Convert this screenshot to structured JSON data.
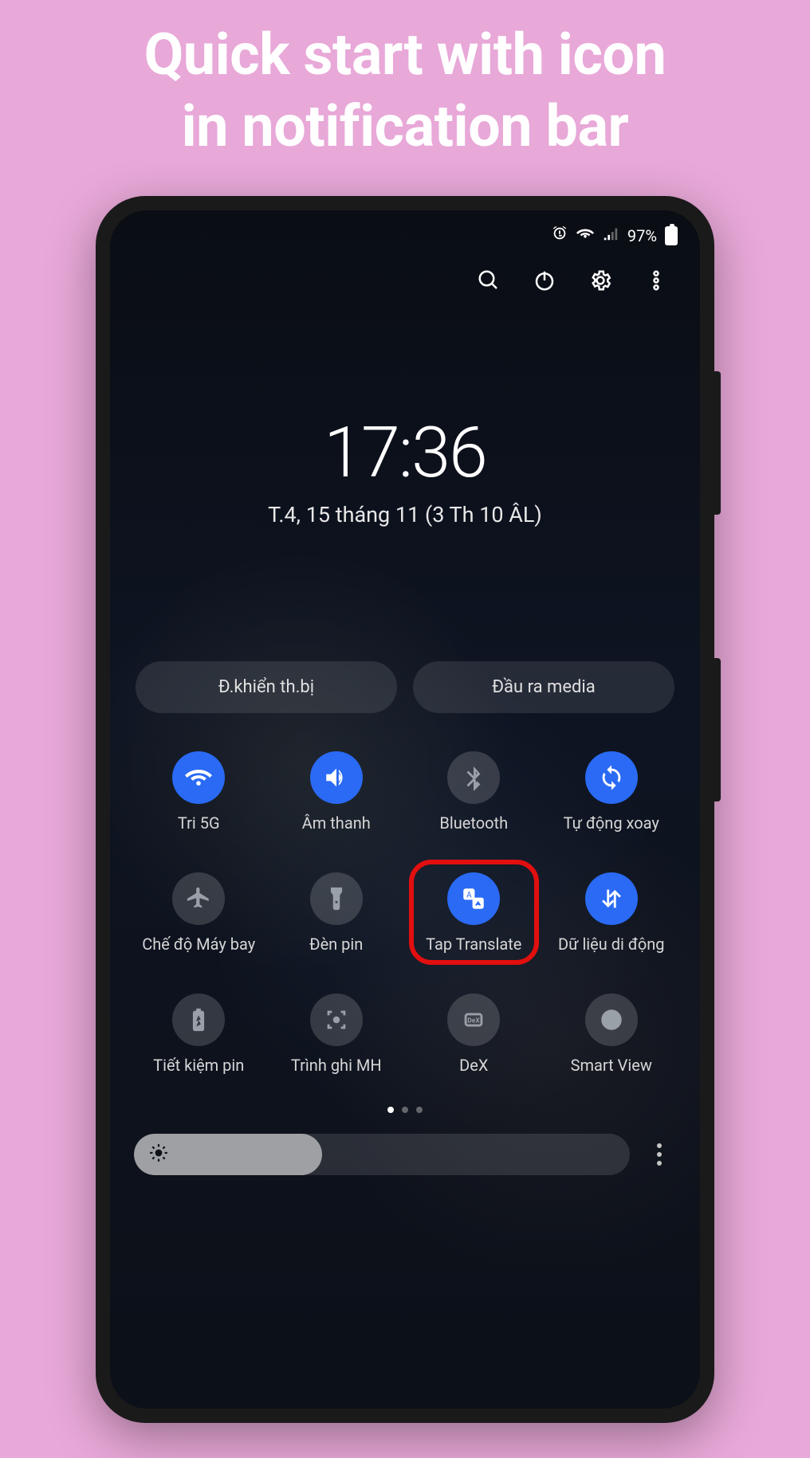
{
  "promo": {
    "line1": "Quick start with icon",
    "line2": "in notification bar"
  },
  "status": {
    "battery_text": "97%"
  },
  "clock": {
    "time": "17:36",
    "date": "T.4, 15 tháng 11 (3 Th 10 ÂL)"
  },
  "pills": {
    "device_control": "Đ.khiển th.bị",
    "media_output": "Đầu ra media"
  },
  "tiles": [
    {
      "label": "Tri 5G",
      "icon": "wifi",
      "active": true
    },
    {
      "label": "Âm thanh",
      "icon": "sound",
      "active": true
    },
    {
      "label": "Bluetooth",
      "icon": "bluetooth",
      "active": false
    },
    {
      "label": "Tự động xoay",
      "icon": "rotate",
      "active": true
    },
    {
      "label": "Chế độ Máy bay",
      "icon": "airplane",
      "active": false
    },
    {
      "label": "Đèn pin",
      "icon": "flashlight",
      "active": false
    },
    {
      "label": "Tap Translate",
      "icon": "translate",
      "active": true,
      "highlight": true
    },
    {
      "label": "Dữ liệu di động",
      "icon": "data",
      "active": true
    },
    {
      "label": "Tiết kiệm pin",
      "icon": "battery-saver",
      "active": false
    },
    {
      "label": "Trình ghi MH",
      "icon": "screen-record",
      "active": false
    },
    {
      "label": "DeX",
      "icon": "dex",
      "active": false
    },
    {
      "label": "Smart View",
      "icon": "smart-view",
      "active": false
    }
  ],
  "brightness": {
    "percent": 38
  },
  "page_indicator": {
    "count": 3,
    "active": 0
  }
}
